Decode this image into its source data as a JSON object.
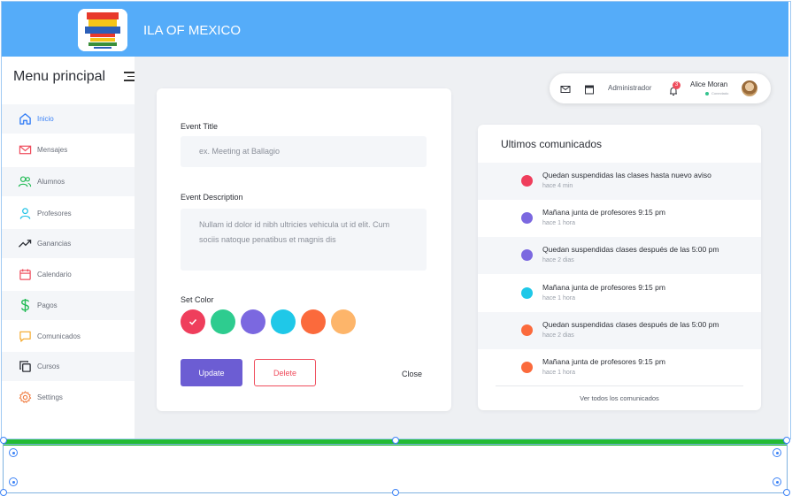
{
  "app": {
    "title": "ILA OF MEXICO"
  },
  "colors": {
    "topbar": "#55acf9",
    "accent": "#6c5dd3",
    "danger": "#ef4d5d"
  },
  "sidebar": {
    "title": "Menu principal",
    "items": [
      {
        "label": "Inicio",
        "icon": "home-icon",
        "color": "#3b82f6"
      },
      {
        "label": "Mensajes",
        "icon": "mail-icon",
        "color": "#ef4d5d"
      },
      {
        "label": "Alumnos",
        "icon": "users-icon",
        "color": "#22bb55"
      },
      {
        "label": "Profesores",
        "icon": "user-icon",
        "color": "#22c3e6"
      },
      {
        "label": "Ganancias",
        "icon": "trending-up-icon",
        "color": "#2c2f36"
      },
      {
        "label": "Calendario",
        "icon": "calendar-icon",
        "color": "#ef4d5d"
      },
      {
        "label": "Pagos",
        "icon": "dollar-icon",
        "color": "#22bb55"
      },
      {
        "label": "Comunicados",
        "icon": "message-icon",
        "color": "#f5a623"
      },
      {
        "label": "Cursos",
        "icon": "copy-icon",
        "color": "#2c2f36"
      },
      {
        "label": "Settings",
        "icon": "gear-icon",
        "color": "#f07b3f"
      }
    ]
  },
  "form": {
    "title_label": "Event Title",
    "title_placeholder": "ex. Meeting at Ballagio",
    "desc_label": "Event Description",
    "desc_placeholder": "Nullam id dolor id nibh ultricies vehicula ut id elit. Cum sociis natoque penatibus et magnis dis",
    "color_label": "Set Color",
    "colors": [
      "#ef3e5c",
      "#2ecc8f",
      "#7b68e0",
      "#1fc8e8",
      "#fb6a3c",
      "#fdb56a"
    ],
    "selected_color": 0,
    "update_label": "Update",
    "delete_label": "Delete",
    "close_label": "Close"
  },
  "userbar": {
    "admin_label": "Administrador",
    "notification_count": "3",
    "user_name": "Alice Moran",
    "user_status": "Conectado"
  },
  "comunicados": {
    "title": "Ultimos comunicados",
    "items": [
      {
        "text": "Quedan suspendidas las clases hasta nuevo aviso",
        "time": "hace 4 min",
        "color": "#ef3e5c"
      },
      {
        "text": "Mañana junta de profesores 9:15 pm",
        "time": "hace 1 hora",
        "color": "#7b68e0"
      },
      {
        "text": "Quedan suspendidas clases después de las 5:00 pm",
        "time": "hace 2 dias",
        "color": "#7b68e0"
      },
      {
        "text": "Mañana junta de profesores 9:15 pm",
        "time": "hace 1 hora",
        "color": "#1fc8e8"
      },
      {
        "text": "Quedan suspendidas clases después de las 5:00 pm",
        "time": "hace 2 dias",
        "color": "#fb6a3c"
      },
      {
        "text": "Mañana junta de profesores 9:15 pm",
        "time": "hace 1 hora",
        "color": "#fb6a3c"
      }
    ],
    "link_label": "Ver todos los comunicados"
  }
}
